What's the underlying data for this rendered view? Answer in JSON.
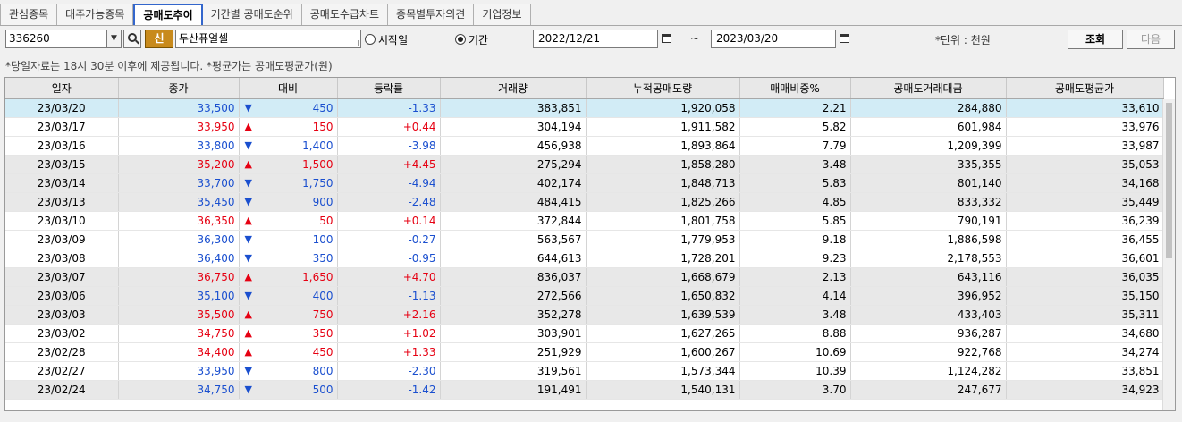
{
  "tabs": [
    {
      "label": "관심종목",
      "active": false
    },
    {
      "label": "대주가능종목",
      "active": false
    },
    {
      "label": "공매도추이",
      "active": true
    },
    {
      "label": "기간별 공매도순위",
      "active": false
    },
    {
      "label": "공매도수급차트",
      "active": false
    },
    {
      "label": "종목별투자의견",
      "active": false
    },
    {
      "label": "기업정보",
      "active": false
    }
  ],
  "toolbar": {
    "stock_code": "336260",
    "new_badge": "신",
    "stock_name": "두산퓨얼셀",
    "radio_start": "시작일",
    "radio_period": "기간",
    "selected_radio": "기간",
    "date_from": "2022/12/21",
    "tilde": "~",
    "date_to": "2023/03/20",
    "unit": "*단위 : 천원",
    "query_button": "조회",
    "next_button": "다음"
  },
  "notice": "*당일자료는 18시 30분 이후에 제공됩니다. *평균가는 공매도평균가(원)",
  "table": {
    "columns": [
      "일자",
      "종가",
      "대비",
      "등락률",
      "거래량",
      "누적공매도량",
      "매매비중%",
      "공매도거래대금",
      "공매도평균가"
    ],
    "rows": [
      {
        "date": "23/03/20",
        "close": "33,500",
        "dir": "down",
        "change": "450",
        "rate": "-1.33",
        "volume": "383,851",
        "cum_short": "1,920,058",
        "ratio": "2.21",
        "short_amount": "284,880",
        "avg_price": "33,610"
      },
      {
        "date": "23/03/17",
        "close": "33,950",
        "dir": "up",
        "change": "150",
        "rate": "+0.44",
        "volume": "304,194",
        "cum_short": "1,911,582",
        "ratio": "5.82",
        "short_amount": "601,984",
        "avg_price": "33,976"
      },
      {
        "date": "23/03/16",
        "close": "33,800",
        "dir": "down",
        "change": "1,400",
        "rate": "-3.98",
        "volume": "456,938",
        "cum_short": "1,893,864",
        "ratio": "7.79",
        "short_amount": "1,209,399",
        "avg_price": "33,987"
      },
      {
        "date": "23/03/15",
        "close": "35,200",
        "dir": "up",
        "change": "1,500",
        "rate": "+4.45",
        "volume": "275,294",
        "cum_short": "1,858,280",
        "ratio": "3.48",
        "short_amount": "335,355",
        "avg_price": "35,053"
      },
      {
        "date": "23/03/14",
        "close": "33,700",
        "dir": "down",
        "change": "1,750",
        "rate": "-4.94",
        "volume": "402,174",
        "cum_short": "1,848,713",
        "ratio": "5.83",
        "short_amount": "801,140",
        "avg_price": "34,168"
      },
      {
        "date": "23/03/13",
        "close": "35,450",
        "dir": "down",
        "change": "900",
        "rate": "-2.48",
        "volume": "484,415",
        "cum_short": "1,825,266",
        "ratio": "4.85",
        "short_amount": "833,332",
        "avg_price": "35,449"
      },
      {
        "date": "23/03/10",
        "close": "36,350",
        "dir": "up",
        "change": "50",
        "rate": "+0.14",
        "volume": "372,844",
        "cum_short": "1,801,758",
        "ratio": "5.85",
        "short_amount": "790,191",
        "avg_price": "36,239"
      },
      {
        "date": "23/03/09",
        "close": "36,300",
        "dir": "down",
        "change": "100",
        "rate": "-0.27",
        "volume": "563,567",
        "cum_short": "1,779,953",
        "ratio": "9.18",
        "short_amount": "1,886,598",
        "avg_price": "36,455"
      },
      {
        "date": "23/03/08",
        "close": "36,400",
        "dir": "down",
        "change": "350",
        "rate": "-0.95",
        "volume": "644,613",
        "cum_short": "1,728,201",
        "ratio": "9.23",
        "short_amount": "2,178,553",
        "avg_price": "36,601"
      },
      {
        "date": "23/03/07",
        "close": "36,750",
        "dir": "up",
        "change": "1,650",
        "rate": "+4.70",
        "volume": "836,037",
        "cum_short": "1,668,679",
        "ratio": "2.13",
        "short_amount": "643,116",
        "avg_price": "36,035"
      },
      {
        "date": "23/03/06",
        "close": "35,100",
        "dir": "down",
        "change": "400",
        "rate": "-1.13",
        "volume": "272,566",
        "cum_short": "1,650,832",
        "ratio": "4.14",
        "short_amount": "396,952",
        "avg_price": "35,150"
      },
      {
        "date": "23/03/03",
        "close": "35,500",
        "dir": "up",
        "change": "750",
        "rate": "+2.16",
        "volume": "352,278",
        "cum_short": "1,639,539",
        "ratio": "3.48",
        "short_amount": "433,403",
        "avg_price": "35,311"
      },
      {
        "date": "23/03/02",
        "close": "34,750",
        "dir": "up",
        "change": "350",
        "rate": "+1.02",
        "volume": "303,901",
        "cum_short": "1,627,265",
        "ratio": "8.88",
        "short_amount": "936,287",
        "avg_price": "34,680"
      },
      {
        "date": "23/02/28",
        "close": "34,400",
        "dir": "up",
        "change": "450",
        "rate": "+1.33",
        "volume": "251,929",
        "cum_short": "1,600,267",
        "ratio": "10.69",
        "short_amount": "922,768",
        "avg_price": "34,274"
      },
      {
        "date": "23/02/27",
        "close": "33,950",
        "dir": "down",
        "change": "800",
        "rate": "-2.30",
        "volume": "319,561",
        "cum_short": "1,573,344",
        "ratio": "10.39",
        "short_amount": "1,124,282",
        "avg_price": "33,851"
      },
      {
        "date": "23/02/24",
        "close": "34,750",
        "dir": "down",
        "change": "500",
        "rate": "-1.42",
        "volume": "191,491",
        "cum_short": "1,540,131",
        "ratio": "3.70",
        "short_amount": "247,677",
        "avg_price": "34,923"
      }
    ]
  },
  "colors": {
    "up": "#e60012",
    "down": "#1a4fcf",
    "selected_row": "#d2ecf6",
    "active_tab_border": "#3366cc",
    "new_badge": "#c88a1c"
  },
  "icons": {
    "up": "▲",
    "down": "▼",
    "dropdown": "▼"
  }
}
